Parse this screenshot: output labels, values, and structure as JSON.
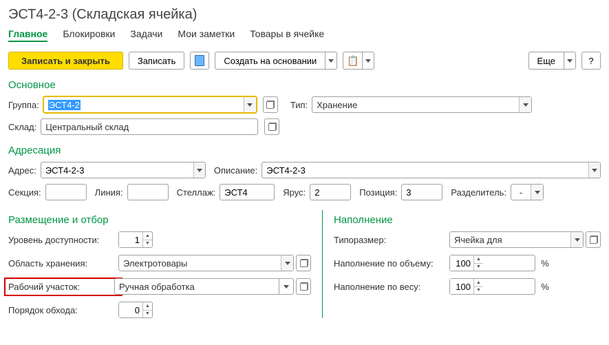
{
  "title": "ЭСТ4-2-3 (Складская ячейка)",
  "tabs": [
    "Главное",
    "Блокировки",
    "Задачи",
    "Мои заметки",
    "Товары в ячейке"
  ],
  "active_tab": 0,
  "toolbar": {
    "save_close": "Записать и закрыть",
    "save": "Записать",
    "create_based": "Создать на основании",
    "more": "Еще",
    "help": "?"
  },
  "sections": {
    "main": "Основное",
    "addressing": "Адресация",
    "placement": "Размещение и отбор",
    "filling": "Наполнение"
  },
  "main": {
    "group_lbl": "Группа:",
    "group_val": "ЭСТ4-2",
    "type_lbl": "Тип:",
    "type_val": "Хранение",
    "warehouse_lbl": "Склад:",
    "warehouse_val": "Центральный склад"
  },
  "addr": {
    "address_lbl": "Адрес:",
    "address_val": "ЭСТ4-2-3",
    "desc_lbl": "Описание:",
    "desc_val": "ЭСТ4-2-3",
    "section_lbl": "Секция:",
    "section_val": "",
    "line_lbl": "Линия:",
    "line_val": "",
    "rack_lbl": "Стеллаж:",
    "rack_val": "ЭСТ4",
    "tier_lbl": "Ярус:",
    "tier_val": "2",
    "pos_lbl": "Позиция:",
    "pos_val": "3",
    "sep_lbl": "Разделитель:",
    "sep_val": "-"
  },
  "placement": {
    "avail_lbl": "Уровень доступности:",
    "avail_val": "1",
    "area_lbl": "Область хранения:",
    "area_val": "Электротовары",
    "workarea_lbl": "Рабочий участок:",
    "workarea_val": "Ручная обработка",
    "order_lbl": "Порядок обхода:",
    "order_val": "0"
  },
  "filling": {
    "size_lbl": "Типоразмер:",
    "size_val": "Ячейка для электротоваров",
    "vol_lbl": "Наполнение по объему:",
    "vol_val": "100",
    "weight_lbl": "Наполнение по весу:",
    "weight_val": "100",
    "percent": "%"
  }
}
